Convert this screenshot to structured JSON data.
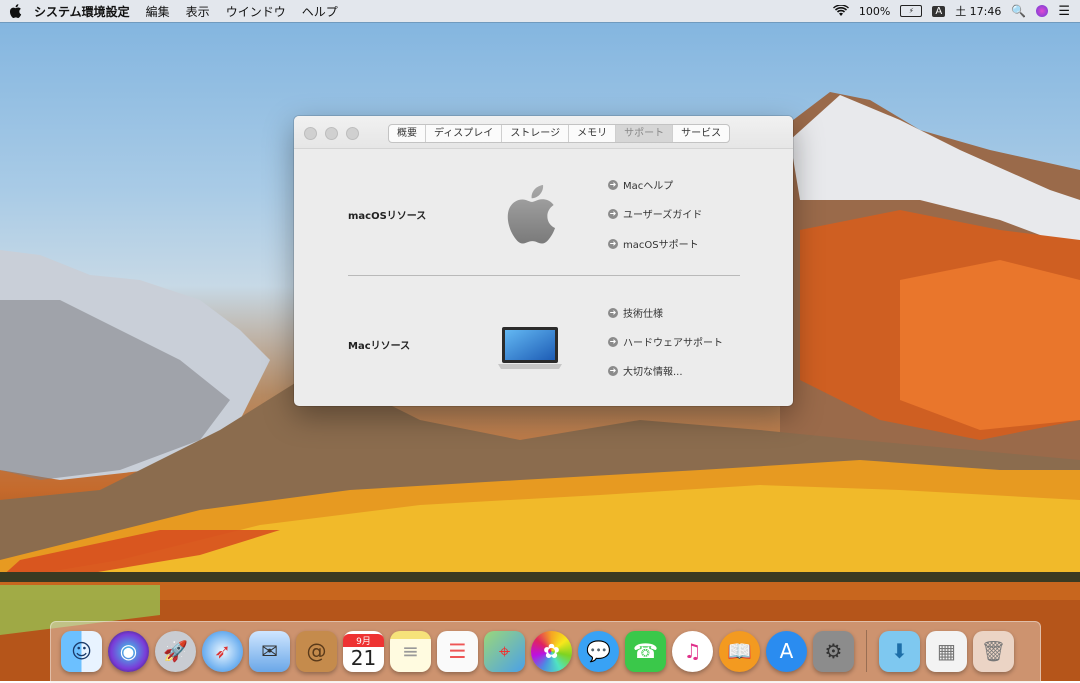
{
  "menubar": {
    "apple_icon": "apple-icon",
    "app_name": "システム環境設定",
    "menus": [
      "編集",
      "表示",
      "ウインドウ",
      "ヘルプ"
    ],
    "battery_percent": "100%",
    "ime_label": "A",
    "clock": "土 17:46"
  },
  "window": {
    "tabs": [
      "概要",
      "ディスプレイ",
      "ストレージ",
      "メモリ",
      "サポート",
      "サービス"
    ],
    "selected_tab": "サポート",
    "sections": [
      {
        "title": "macOSリソース",
        "links": [
          "Macヘルプ",
          "ユーザーズガイド",
          "macOSサポート"
        ]
      },
      {
        "title": "Macリソース",
        "links": [
          "技術仕様",
          "ハードウェアサポート",
          "大切な情報..."
        ]
      }
    ]
  },
  "dock": {
    "apps": [
      "finder",
      "siri",
      "launchpad",
      "safari",
      "mail",
      "contacts",
      "calendar",
      "notes",
      "reminders",
      "maps",
      "photos",
      "messages",
      "facetime",
      "itunes",
      "ibooks",
      "app-store",
      "system-preferences"
    ],
    "calendar_day": "21",
    "calendar_month": "9月",
    "right_items": [
      "downloads-folder",
      "recent-files",
      "trash"
    ]
  }
}
